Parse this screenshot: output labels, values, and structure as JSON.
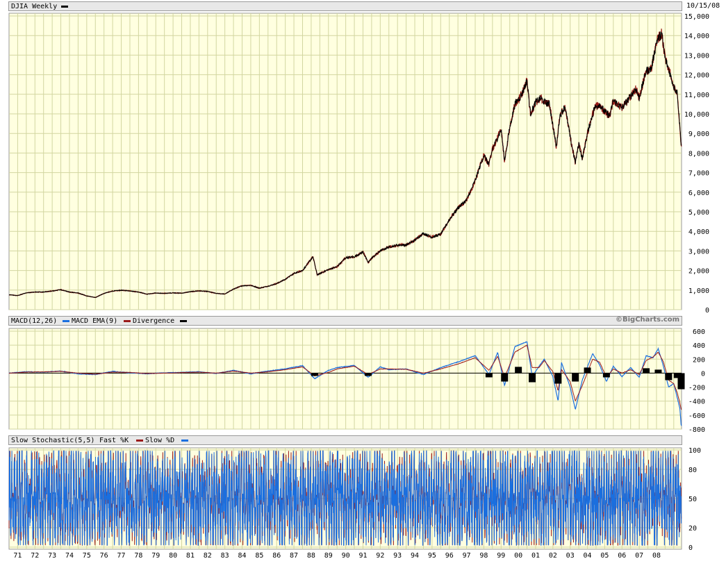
{
  "header": {
    "title": "DJIA Weekly",
    "date": "10/15/08",
    "credit": "©BigCharts.com"
  },
  "colors": {
    "panel_bg": "#ffffe0",
    "grid": "#d2d6a0",
    "price_line": "#000000",
    "price_highlight": "#8b0000",
    "macd": "#1a6fdf",
    "macd_ema": "#9b1b1b",
    "divergence": "#000000",
    "fast_k": "#9b1b1b",
    "slow_d": "#1a6fdf"
  },
  "indicators": {
    "macd_label": "MACD(12,26)",
    "macd_ema_label": "MACD EMA(9)",
    "divergence_label": "Divergence",
    "stoch_label": "Slow Stochastic(5,5)",
    "fast_k_label": "Fast %K",
    "slow_d_label": "Slow %D"
  },
  "x_axis": {
    "tick_labels": [
      "71",
      "72",
      "73",
      "74",
      "75",
      "76",
      "77",
      "78",
      "79",
      "80",
      "81",
      "82",
      "83",
      "84",
      "85",
      "86",
      "87",
      "88",
      "89",
      "90",
      "91",
      "92",
      "93",
      "94",
      "95",
      "96",
      "97",
      "98",
      "99",
      "00",
      "01",
      "02",
      "03",
      "04",
      "05",
      "06",
      "07",
      "08"
    ]
  },
  "chart_data": [
    {
      "type": "line",
      "title": "DJIA Weekly",
      "x_unit": "year",
      "ylim": [
        0,
        15000
      ],
      "y_ticks": [
        "0",
        "1,000",
        "2,000",
        "3,000",
        "4,000",
        "5,000",
        "6,000",
        "7,000",
        "8,000",
        "9,000",
        "10,000",
        "11,000",
        "12,000",
        "13,000",
        "14,000",
        "15,000"
      ],
      "series": [
        {
          "name": "DJIA Weekly",
          "points": [
            [
              1970.0,
              760
            ],
            [
              1970.5,
              720
            ],
            [
              1971.0,
              860
            ],
            [
              1971.5,
              900
            ],
            [
              1972.0,
              900
            ],
            [
              1972.5,
              950
            ],
            [
              1973.0,
              1020
            ],
            [
              1973.5,
              900
            ],
            [
              1974.0,
              850
            ],
            [
              1974.5,
              700
            ],
            [
              1975.0,
              620
            ],
            [
              1975.5,
              830
            ],
            [
              1976.0,
              950
            ],
            [
              1976.5,
              990
            ],
            [
              1977.0,
              960
            ],
            [
              1977.5,
              900
            ],
            [
              1978.0,
              790
            ],
            [
              1978.5,
              850
            ],
            [
              1979.0,
              830
            ],
            [
              1979.5,
              860
            ],
            [
              1980.0,
              840
            ],
            [
              1980.5,
              920
            ],
            [
              1981.0,
              960
            ],
            [
              1981.5,
              930
            ],
            [
              1982.0,
              830
            ],
            [
              1982.5,
              800
            ],
            [
              1983.0,
              1050
            ],
            [
              1983.5,
              1220
            ],
            [
              1984.0,
              1240
            ],
            [
              1984.5,
              1100
            ],
            [
              1985.0,
              1200
            ],
            [
              1985.5,
              1330
            ],
            [
              1986.0,
              1550
            ],
            [
              1986.5,
              1850
            ],
            [
              1987.0,
              2000
            ],
            [
              1987.6,
              2700
            ],
            [
              1987.85,
              1780
            ],
            [
              1988.5,
              2050
            ],
            [
              1989.0,
              2200
            ],
            [
              1989.5,
              2650
            ],
            [
              1990.0,
              2700
            ],
            [
              1990.5,
              2950
            ],
            [
              1990.8,
              2400
            ],
            [
              1991.0,
              2630
            ],
            [
              1991.5,
              3000
            ],
            [
              1992.0,
              3200
            ],
            [
              1992.5,
              3300
            ],
            [
              1993.0,
              3300
            ],
            [
              1993.5,
              3550
            ],
            [
              1994.0,
              3900
            ],
            [
              1994.5,
              3700
            ],
            [
              1995.0,
              3850
            ],
            [
              1995.5,
              4600
            ],
            [
              1996.0,
              5200
            ],
            [
              1996.5,
              5600
            ],
            [
              1997.0,
              6600
            ],
            [
              1997.5,
              7900
            ],
            [
              1997.8,
              7400
            ],
            [
              1998.0,
              8200
            ],
            [
              1998.5,
              9200
            ],
            [
              1998.7,
              7600
            ],
            [
              1999.0,
              9300
            ],
            [
              1999.3,
              10500
            ],
            [
              1999.7,
              11000
            ],
            [
              2000.0,
              11700
            ],
            [
              2000.2,
              10000
            ],
            [
              2000.5,
              10600
            ],
            [
              2000.8,
              10800
            ],
            [
              2001.0,
              10600
            ],
            [
              2001.3,
              10500
            ],
            [
              2001.7,
              8300
            ],
            [
              2001.9,
              9900
            ],
            [
              2002.2,
              10400
            ],
            [
              2002.5,
              8800
            ],
            [
              2002.8,
              7500
            ],
            [
              2003.0,
              8500
            ],
            [
              2003.2,
              7700
            ],
            [
              2003.5,
              9000
            ],
            [
              2003.9,
              10300
            ],
            [
              2004.2,
              10500
            ],
            [
              2004.5,
              10100
            ],
            [
              2004.8,
              9900
            ],
            [
              2005.0,
              10700
            ],
            [
              2005.5,
              10300
            ],
            [
              2006.0,
              10900
            ],
            [
              2006.3,
              11300
            ],
            [
              2006.5,
              10800
            ],
            [
              2006.9,
              12200
            ],
            [
              2007.2,
              12300
            ],
            [
              2007.5,
              13700
            ],
            [
              2007.8,
              14100
            ],
            [
              2008.0,
              12800
            ],
            [
              2008.2,
              12300
            ],
            [
              2008.5,
              11400
            ],
            [
              2008.7,
              11100
            ],
            [
              2008.85,
              9400
            ],
            [
              2008.93,
              8400
            ]
          ]
        }
      ]
    },
    {
      "type": "line",
      "title": "MACD(12,26)",
      "ylim": [
        -800,
        600
      ],
      "y_ticks": [
        "600",
        "400",
        "200",
        "0",
        "-200",
        "-400",
        "-600",
        "-800"
      ],
      "series": [
        {
          "name": "MACD(12,26)",
          "points": [
            [
              1970.0,
              0
            ],
            [
              1971.0,
              20
            ],
            [
              1972.0,
              15
            ],
            [
              1973.0,
              30
            ],
            [
              1974.0,
              -10
            ],
            [
              1975.0,
              -20
            ],
            [
              1976.0,
              25
            ],
            [
              1977.0,
              5
            ],
            [
              1978.0,
              -10
            ],
            [
              1979.0,
              5
            ],
            [
              1980.0,
              10
            ],
            [
              1981.0,
              20
            ],
            [
              1982.0,
              -5
            ],
            [
              1983.0,
              40
            ],
            [
              1984.0,
              -10
            ],
            [
              1985.0,
              30
            ],
            [
              1986.0,
              60
            ],
            [
              1987.0,
              110
            ],
            [
              1987.7,
              -80
            ],
            [
              1988.5,
              40
            ],
            [
              1989.0,
              80
            ],
            [
              1990.0,
              110
            ],
            [
              1990.8,
              -60
            ],
            [
              1991.5,
              90
            ],
            [
              1992.0,
              50
            ],
            [
              1993.0,
              60
            ],
            [
              1994.0,
              -20
            ],
            [
              1995.0,
              80
            ],
            [
              1996.0,
              160
            ],
            [
              1997.0,
              250
            ],
            [
              1997.8,
              -20
            ],
            [
              1998.3,
              300
            ],
            [
              1998.7,
              -180
            ],
            [
              1999.3,
              380
            ],
            [
              2000.0,
              450
            ],
            [
              2000.3,
              -50
            ],
            [
              2000.7,
              100
            ],
            [
              2001.0,
              200
            ],
            [
              2001.5,
              -50
            ],
            [
              2001.8,
              -400
            ],
            [
              2002.0,
              150
            ],
            [
              2002.5,
              -200
            ],
            [
              2002.8,
              -520
            ],
            [
              2003.2,
              -100
            ],
            [
              2003.8,
              280
            ],
            [
              2004.2,
              120
            ],
            [
              2004.6,
              -120
            ],
            [
              2005.0,
              100
            ],
            [
              2005.5,
              -50
            ],
            [
              2006.0,
              80
            ],
            [
              2006.5,
              -60
            ],
            [
              2006.9,
              250
            ],
            [
              2007.3,
              220
            ],
            [
              2007.6,
              350
            ],
            [
              2007.9,
              100
            ],
            [
              2008.2,
              -200
            ],
            [
              2008.5,
              -150
            ],
            [
              2008.7,
              -350
            ],
            [
              2008.85,
              -500
            ],
            [
              2008.93,
              -750
            ]
          ]
        },
        {
          "name": "MACD EMA(9)",
          "points": [
            [
              1970.0,
              0
            ],
            [
              1971.0,
              15
            ],
            [
              1972.0,
              18
            ],
            [
              1973.0,
              25
            ],
            [
              1974.0,
              0
            ],
            [
              1975.0,
              -15
            ],
            [
              1976.0,
              15
            ],
            [
              1977.0,
              10
            ],
            [
              1978.0,
              -5
            ],
            [
              1979.0,
              0
            ],
            [
              1980.0,
              8
            ],
            [
              1981.0,
              15
            ],
            [
              1982.0,
              0
            ],
            [
              1983.0,
              30
            ],
            [
              1984.0,
              0
            ],
            [
              1985.0,
              20
            ],
            [
              1986.0,
              50
            ],
            [
              1987.0,
              90
            ],
            [
              1987.7,
              -40
            ],
            [
              1988.5,
              10
            ],
            [
              1989.0,
              60
            ],
            [
              1990.0,
              100
            ],
            [
              1990.8,
              -20
            ],
            [
              1991.5,
              60
            ],
            [
              1992.0,
              60
            ],
            [
              1993.0,
              55
            ],
            [
              1994.0,
              0
            ],
            [
              1995.0,
              60
            ],
            [
              1996.0,
              130
            ],
            [
              1997.0,
              220
            ],
            [
              1997.8,
              40
            ],
            [
              1998.3,
              240
            ],
            [
              1998.7,
              -60
            ],
            [
              1999.3,
              300
            ],
            [
              2000.0,
              400
            ],
            [
              2000.3,
              80
            ],
            [
              2000.7,
              80
            ],
            [
              2001.0,
              180
            ],
            [
              2001.5,
              20
            ],
            [
              2001.8,
              -250
            ],
            [
              2002.0,
              50
            ],
            [
              2002.5,
              -120
            ],
            [
              2002.8,
              -400
            ],
            [
              2003.2,
              -180
            ],
            [
              2003.8,
              200
            ],
            [
              2004.2,
              160
            ],
            [
              2004.6,
              -60
            ],
            [
              2005.0,
              60
            ],
            [
              2005.5,
              0
            ],
            [
              2006.0,
              50
            ],
            [
              2006.5,
              -20
            ],
            [
              2006.9,
              180
            ],
            [
              2007.3,
              230
            ],
            [
              2007.6,
              300
            ],
            [
              2007.9,
              160
            ],
            [
              2008.2,
              -100
            ],
            [
              2008.5,
              -150
            ],
            [
              2008.7,
              -280
            ],
            [
              2008.85,
              -420
            ],
            [
              2008.93,
              -520
            ]
          ]
        },
        {
          "name": "Divergence",
          "points": [
            [
              1987.7,
              -40
            ],
            [
              1990.8,
              -40
            ],
            [
              1997.8,
              -60
            ],
            [
              1998.7,
              -120
            ],
            [
              1999.5,
              90
            ],
            [
              2000.3,
              -130
            ],
            [
              2001.8,
              -150
            ],
            [
              2002.8,
              -120
            ],
            [
              2003.5,
              80
            ],
            [
              2004.6,
              -60
            ],
            [
              2006.9,
              70
            ],
            [
              2007.6,
              50
            ],
            [
              2008.2,
              -100
            ],
            [
              2008.7,
              -70
            ],
            [
              2008.93,
              -230
            ]
          ]
        }
      ]
    },
    {
      "type": "line",
      "title": "Slow Stochastic(5,5)",
      "ylim": [
        0,
        100
      ],
      "y_ticks": [
        "100",
        "80",
        "50",
        "20",
        "0"
      ],
      "series": [
        {
          "name": "Fast %K",
          "value_range": [
            2,
            100
          ]
        },
        {
          "name": "Slow %D",
          "value_range": [
            5,
            98
          ]
        }
      ]
    }
  ]
}
